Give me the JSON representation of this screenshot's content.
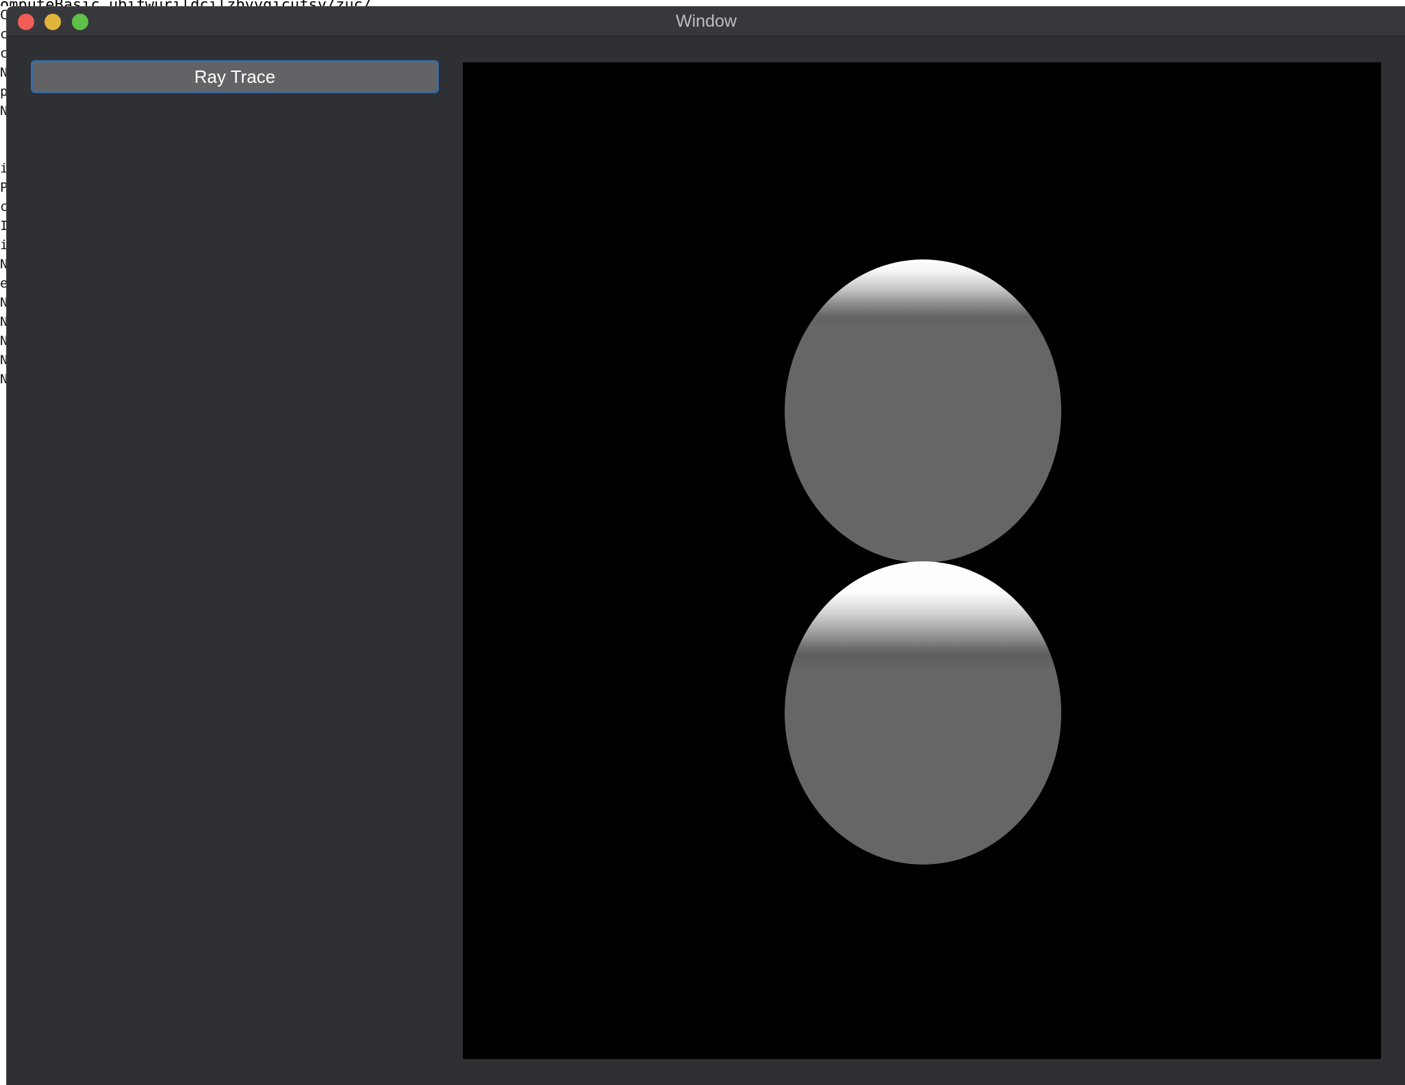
{
  "background_terminal": {
    "top_line": "omputeBasic  ubifwurildcilzbvvgicufsy/zuc/",
    "column_chars": [
      "C",
      "c",
      "c",
      "N",
      "p",
      "N",
      "",
      "",
      "i",
      "P",
      "c",
      "I",
      "i",
      "N",
      "e",
      "N",
      "N",
      "N",
      "N",
      "N"
    ]
  },
  "window": {
    "title": "Window",
    "controls": {
      "close": "close-icon",
      "minimize": "minimize-icon",
      "zoom": "zoom-icon"
    }
  },
  "sidebar": {
    "ray_trace_label": "Ray Trace"
  },
  "render_view": {
    "background_color": "#000000",
    "sphere_base_color": "#666666",
    "highlight_color": "#ffffff"
  }
}
